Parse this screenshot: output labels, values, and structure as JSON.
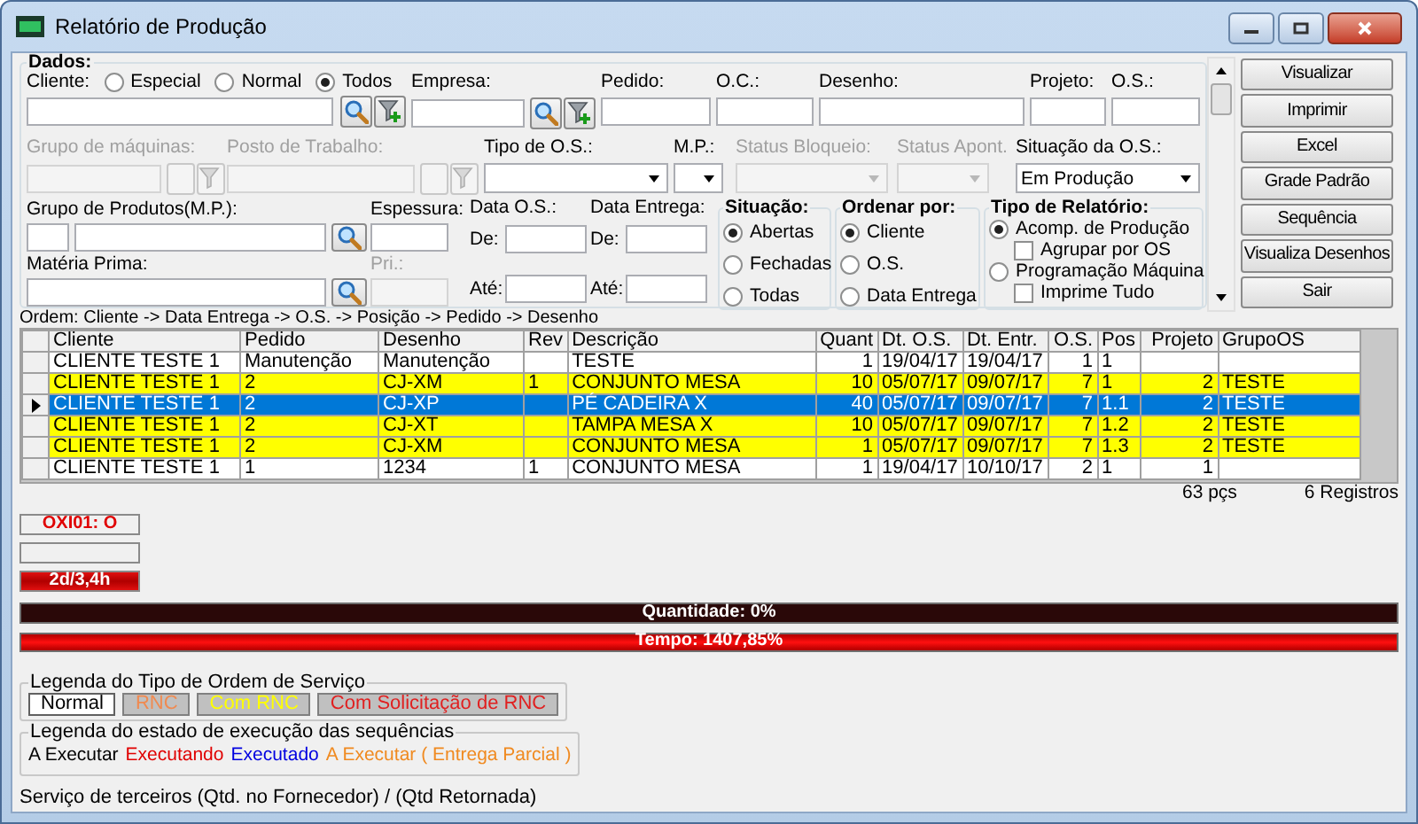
{
  "window": {
    "title": "Relatório de Produção"
  },
  "form": {
    "title": "Dados:",
    "cliente": {
      "label": "Cliente:",
      "options": [
        {
          "label": "Especial",
          "selected": false
        },
        {
          "label": "Normal",
          "selected": false
        },
        {
          "label": "Todos",
          "selected": true
        }
      ]
    },
    "empresa": {
      "label": "Empresa:",
      "disabled": false
    },
    "pedido": {
      "label": "Pedido:",
      "disabled": false
    },
    "oc": {
      "label": "O.C.:",
      "disabled": false
    },
    "desenho": {
      "label": "Desenho:",
      "disabled": false
    },
    "projeto": {
      "label": "Projeto:",
      "disabled": false
    },
    "os": {
      "label": "O.S.:",
      "disabled": false
    },
    "grupo_maquinas": {
      "label": "Grupo de máquinas:",
      "disabled": true
    },
    "posto_trabalho": {
      "label": "Posto de Trabalho:",
      "disabled": true
    },
    "tipo_os": {
      "label": "Tipo de O.S.:",
      "disabled": false
    },
    "mp": {
      "label": "M.P.:",
      "disabled": false
    },
    "status_bloqueio": {
      "label": "Status Bloqueio:",
      "disabled": true
    },
    "status_apont": {
      "label": "Status Apont.",
      "disabled": true
    },
    "situacao_os": {
      "label": "Situação da O.S.:",
      "value": "Em Produção",
      "disabled": false
    },
    "grupo_produtos": {
      "label": "Grupo de Produtos(M.P.):",
      "disabled": false
    },
    "espessura": {
      "label": "Espessura:",
      "disabled": false
    },
    "materia_prima": {
      "label": "Matéria Prima:",
      "disabled": false
    },
    "pri": {
      "label": "Pri.:",
      "disabled": true
    },
    "data_os": {
      "label": "Data O.S.:",
      "from": "De:",
      "to": "Até:",
      "disabled": false
    },
    "data_entrega": {
      "label": "Data Entrega:",
      "from": "De:",
      "to": "Até:",
      "disabled": false
    },
    "situacao": {
      "title": "Situação:",
      "options": [
        {
          "label": "Abertas",
          "selected": true
        },
        {
          "label": "Fechadas",
          "selected": false
        },
        {
          "label": "Todas",
          "selected": false
        }
      ]
    },
    "ordenar": {
      "title": "Ordenar por:",
      "options": [
        {
          "label": "Cliente",
          "selected": true
        },
        {
          "label": "O.S.",
          "selected": false
        },
        {
          "label": "Data Entrega",
          "selected": false
        }
      ]
    },
    "tipo_relatorio": {
      "title": "Tipo de Relatório:",
      "options": [
        {
          "label": "Acomp. de Produção",
          "selected": true,
          "option": {
            "label": "Agrupar por OS",
            "checked": false
          }
        },
        {
          "label": "Programação Máquina",
          "selected": false,
          "option": {
            "label": "Imprime Tudo",
            "checked": false
          }
        }
      ]
    }
  },
  "buttons": [
    {
      "label": "Visualizar"
    },
    {
      "label": "Imprimir"
    },
    {
      "label": "Excel"
    },
    {
      "label": "Grade Padrão"
    },
    {
      "label": "Sequência"
    },
    {
      "label": "Visualiza Desenhos"
    },
    {
      "label": "Sair"
    }
  ],
  "order": "Ordem: Cliente -> Data Entrega -> O.S. -> Posição -> Pedido -> Desenho",
  "table": {
    "columns": [
      "Cliente",
      "Pedido",
      "Desenho",
      "Rev",
      "Descrição",
      "Quant",
      "Dt. O.S.",
      "Dt. Entr.",
      "O.S.",
      "Pos",
      "Projeto",
      "GrupoOS"
    ],
    "rows": [
      {
        "selected": false,
        "color": "#ffffff",
        "cells": [
          "CLIENTE TESTE 1",
          "Manutenção",
          "Manutenção",
          null,
          "TESTE",
          "1",
          "19/04/17",
          "19/04/17",
          "1",
          "1",
          null,
          null
        ]
      },
      {
        "selected": false,
        "color": "#ffff00",
        "cells": [
          "CLIENTE TESTE 1",
          "2",
          "CJ-XM",
          "1",
          "CONJUNTO MESA",
          "10",
          "05/07/17",
          "09/07/17",
          "7",
          "1",
          "2",
          "TESTE"
        ]
      },
      {
        "selected": true,
        "cells": [
          "CLIENTE TESTE 1",
          "2",
          "CJ-XP",
          null,
          "PÉ CADEIRA X",
          "40",
          "05/07/17",
          "09/07/17",
          "7",
          "1.1",
          "2",
          "TESTE"
        ]
      },
      {
        "selected": false,
        "color": "#ffff00",
        "cells": [
          "CLIENTE TESTE 1",
          "2",
          "CJ-XT",
          null,
          "TAMPA MESA X",
          "10",
          "05/07/17",
          "09/07/17",
          "7",
          "1.2",
          "2",
          "TESTE"
        ]
      },
      {
        "selected": false,
        "color": "#ffff00",
        "cells": [
          "CLIENTE TESTE 1",
          "2",
          "CJ-XM",
          null,
          "CONJUNTO MESA",
          "1",
          "05/07/17",
          "09/07/17",
          "7",
          "1.3",
          "2",
          "TESTE"
        ]
      },
      {
        "selected": false,
        "color": "#ffffff",
        "cells": [
          "CLIENTE TESTE 1",
          "1",
          "1234",
          "1",
          "CONJUNTO MESA",
          "1",
          "19/04/17",
          "10/10/17",
          "2",
          "1",
          "1",
          null
        ]
      }
    ]
  },
  "totals": {
    "pieces": "63 pçs",
    "records": "6 Registros"
  },
  "indicators": [
    {
      "kind": "alert",
      "text": "OXI01: O"
    },
    {
      "kind": "blank"
    },
    {
      "kind": "late",
      "text": "2d/3,4h"
    }
  ],
  "progress": [
    {
      "label": "Quantidade: 0%",
      "level": 0
    },
    {
      "label": "Tempo: 1407,85%",
      "level": 1
    }
  ],
  "legend_os_type": {
    "title": "Legenda do Tipo de Ordem de Serviço",
    "items": [
      {
        "label": "Normal",
        "kind": "plain",
        "color": "#000000"
      },
      {
        "label": "RNC",
        "kind": "shaded",
        "color": "#f08a50"
      },
      {
        "label": "Com RNC",
        "kind": "shaded",
        "color": "#ffff00"
      },
      {
        "label": "Com Solicitação de RNC",
        "kind": "shaded",
        "color": "#e02020"
      }
    ]
  },
  "legend_execution": {
    "title": "Legenda do estado de execução das sequências",
    "items": [
      {
        "label": "A Executar",
        "color": "#000000"
      },
      {
        "label": "Executando",
        "color": "#e00000"
      },
      {
        "label": "Executado",
        "color": "#0000e0"
      },
      {
        "label": "A Executar ( Entrega Parcial )",
        "color": "#f08a20"
      }
    ]
  },
  "footer": "Serviço de terceiros (Qtd. no Fornecedor) / (Qtd Retornada)"
}
